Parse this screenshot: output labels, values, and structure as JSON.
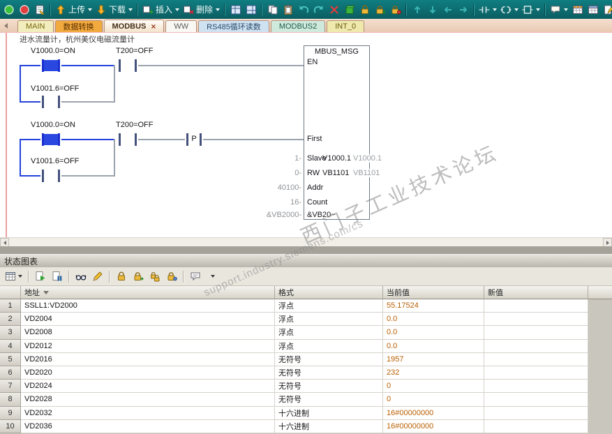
{
  "toolbar": {
    "upload_label": "上传",
    "download_label": "下载",
    "insert_label": "插入",
    "delete_label": "删除"
  },
  "tabs": [
    {
      "label": "MAIN"
    },
    {
      "label": "数据转换"
    },
    {
      "label": "MODBUS",
      "close": "×"
    },
    {
      "label": "WW"
    },
    {
      "label": "RS485循环读数"
    },
    {
      "label": "MODBUS2"
    },
    {
      "label": "INT_0"
    }
  ],
  "ladder": {
    "comment": "进水流量计，杭州美仪电磁流量计",
    "rung1": {
      "contact1": "V1000.0=ON",
      "contact2": "T200=OFF",
      "branch": "V1001.6=OFF"
    },
    "rung2": {
      "contact1": "V1000.0=ON",
      "contact2": "T200=OFF",
      "edge": "P",
      "branch": "V1001.6=OFF"
    },
    "block": {
      "title": "MBUS_MSG",
      "en": "EN",
      "first": "First",
      "rows": [
        {
          "value": "1-",
          "label": "Slave",
          "operand": "V1000.1",
          "live": "V1000.1"
        },
        {
          "value": "0-",
          "label": "RW",
          "operand": "VB1101",
          "live": "VB1101"
        },
        {
          "value": "40100-",
          "label": "Addr"
        },
        {
          "value": "16-",
          "label": "Count"
        },
        {
          "value": "&VB2000-",
          "label": "&VB20~"
        }
      ]
    }
  },
  "watermark": {
    "line1": "西门子工业技术论坛",
    "line2": "support.industry.siemens.com/cs"
  },
  "status_chart": {
    "title": "状态图表",
    "columns": {
      "address": "地址",
      "format": "格式",
      "current": "当前值",
      "newval": "新值"
    },
    "rows": [
      {
        "num": "1",
        "address": "SSLL1:VD2000",
        "format": "浮点",
        "value": "55.17524",
        "new_value": ""
      },
      {
        "num": "2",
        "address": "VD2004",
        "format": "浮点",
        "value": "0.0",
        "new_value": ""
      },
      {
        "num": "3",
        "address": "VD2008",
        "format": "浮点",
        "value": "0.0",
        "new_value": ""
      },
      {
        "num": "4",
        "address": "VD2012",
        "format": "浮点",
        "value": "0.0",
        "new_value": ""
      },
      {
        "num": "5",
        "address": "VD2016",
        "format": "无符号",
        "value": "1957",
        "new_value": ""
      },
      {
        "num": "6",
        "address": "VD2020",
        "format": "无符号",
        "value": "232",
        "new_value": ""
      },
      {
        "num": "7",
        "address": "VD2024",
        "format": "无符号",
        "value": "0",
        "new_value": ""
      },
      {
        "num": "8",
        "address": "VD2028",
        "format": "无符号",
        "value": "0",
        "new_value": ""
      },
      {
        "num": "9",
        "address": "VD2032",
        "format": "十六进制",
        "value": "16#00000000",
        "new_value": ""
      },
      {
        "num": "10",
        "address": "VD2036",
        "format": "十六进制",
        "value": "16#00000000",
        "new_value": ""
      }
    ]
  }
}
